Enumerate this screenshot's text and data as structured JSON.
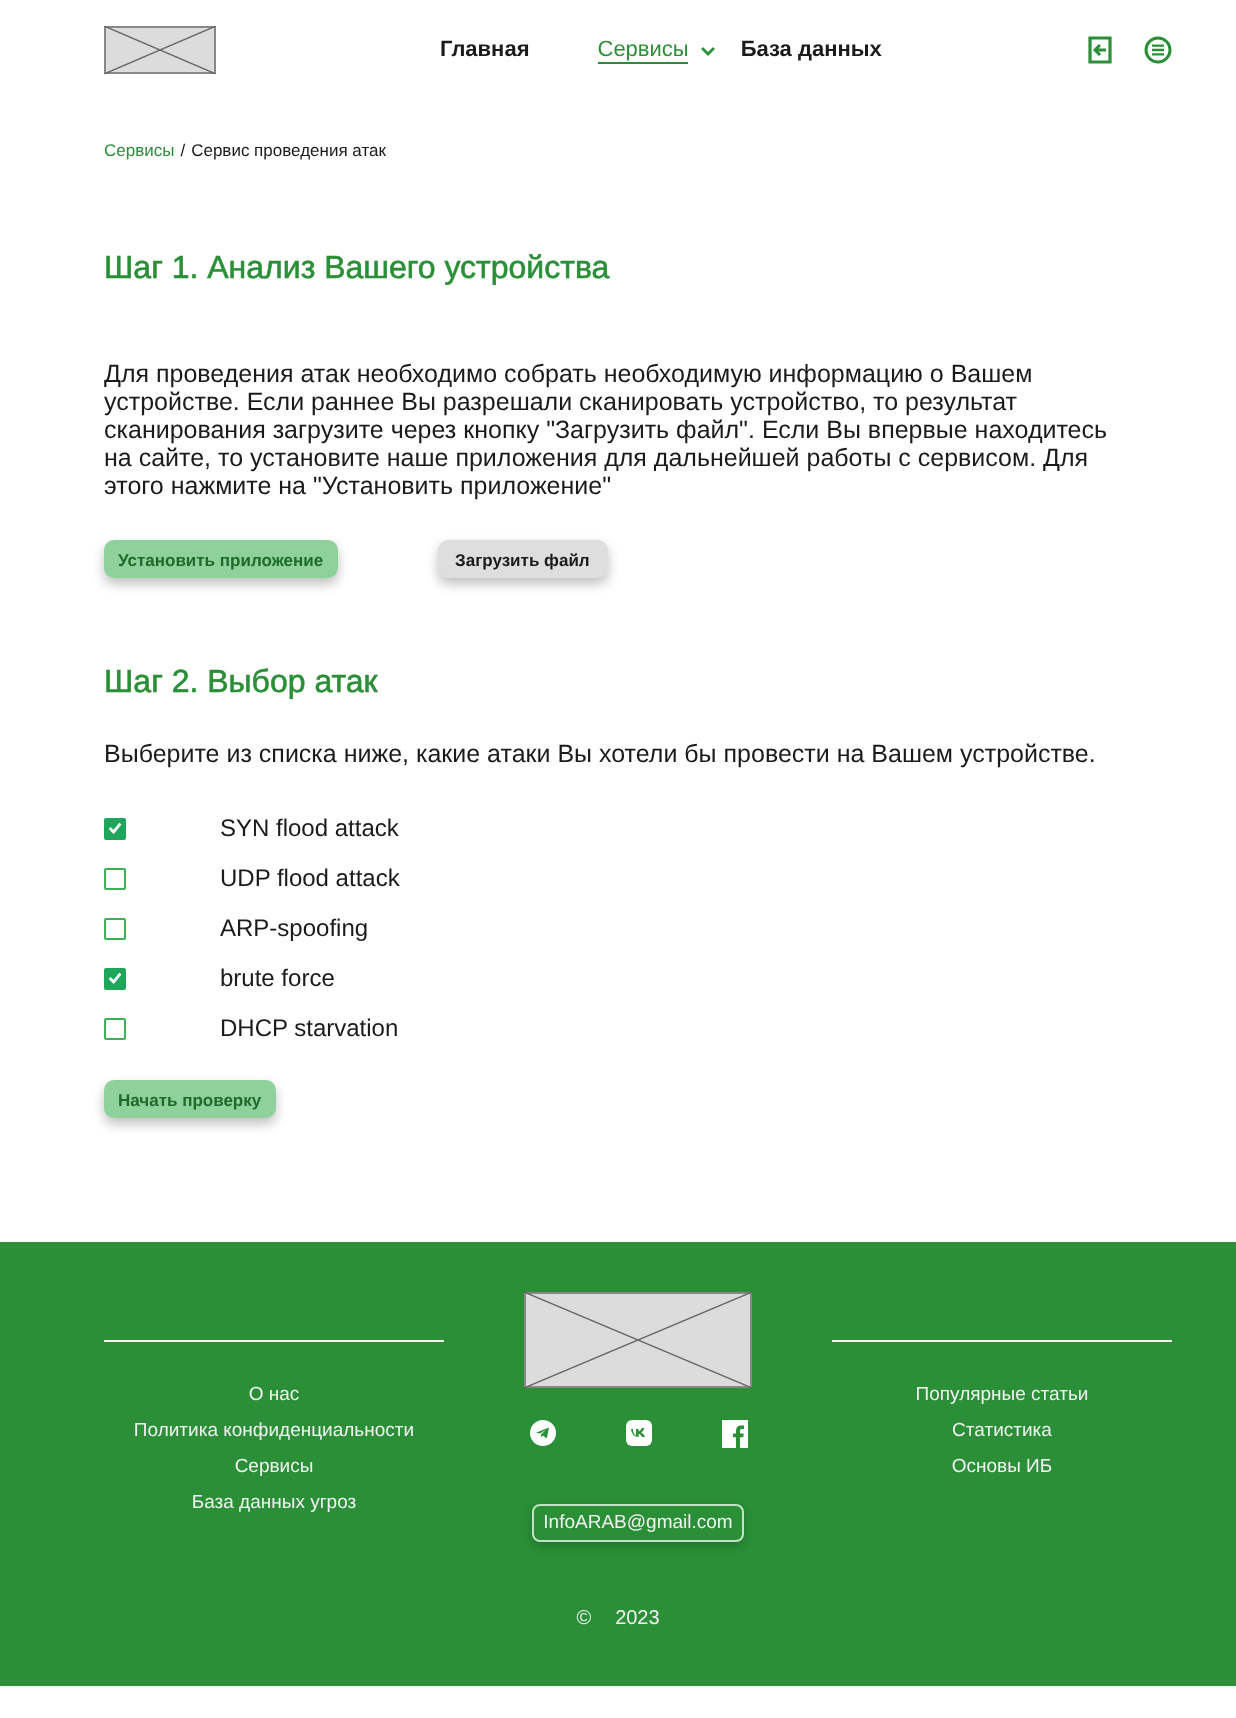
{
  "header": {
    "nav": [
      {
        "label": "Главная",
        "selected": false,
        "kind": "link"
      },
      {
        "label": "Сервисы",
        "selected": true,
        "kind": "dropdown"
      },
      {
        "label": "База данных",
        "selected": false,
        "kind": "link"
      }
    ]
  },
  "breadcrumb": {
    "parent": "Сервисы",
    "separator": "/",
    "current": "Сервис проведения атак"
  },
  "step1": {
    "title": "Шаг 1. Анализ Вашего устройства",
    "text": "Для проведения атак необходимо собрать необходимую информацию о Вашем устройстве. Если раннее Вы разрешали сканировать устройство, то результат сканирования загрузите через кнопку \"Загрузить файл\". Если Вы впервые находитесь на сайте, то установите наше приложения для дальнейшей работы с сервисом. Для этого нажмите на \"Установить приложение\"",
    "buttons": [
      {
        "label": "Установить приложение",
        "kind": "primary"
      },
      {
        "label": "Загрузить файл",
        "kind": "secondary"
      }
    ]
  },
  "step2": {
    "title": "Шаг 2. Выбор атак",
    "text": "Выберите из списка ниже, какие атаки Вы хотели бы провести на Вашем устройстве.",
    "attacks": [
      {
        "label": "SYN flood attack",
        "checked": true
      },
      {
        "label": "UDP flood attack",
        "checked": false
      },
      {
        "label": "ARP-spoofing",
        "checked": false
      },
      {
        "label": "brute force",
        "checked": true
      },
      {
        "label": "DHCP starvation",
        "checked": false
      }
    ],
    "button": "Начать проверку"
  },
  "footer": {
    "left_links": [
      "О нас",
      "Политика конфиденциальности",
      "Сервисы",
      "База данных угроз"
    ],
    "right_links": [
      "Популярные статьи",
      "Статистика",
      "Основы ИБ"
    ],
    "social": [
      {
        "kind": "telegram"
      },
      {
        "kind": "vk"
      },
      {
        "kind": "facebook"
      }
    ],
    "email": "InfoARAB@gmail.com",
    "copyright_sign": "©",
    "year": "2023"
  }
}
